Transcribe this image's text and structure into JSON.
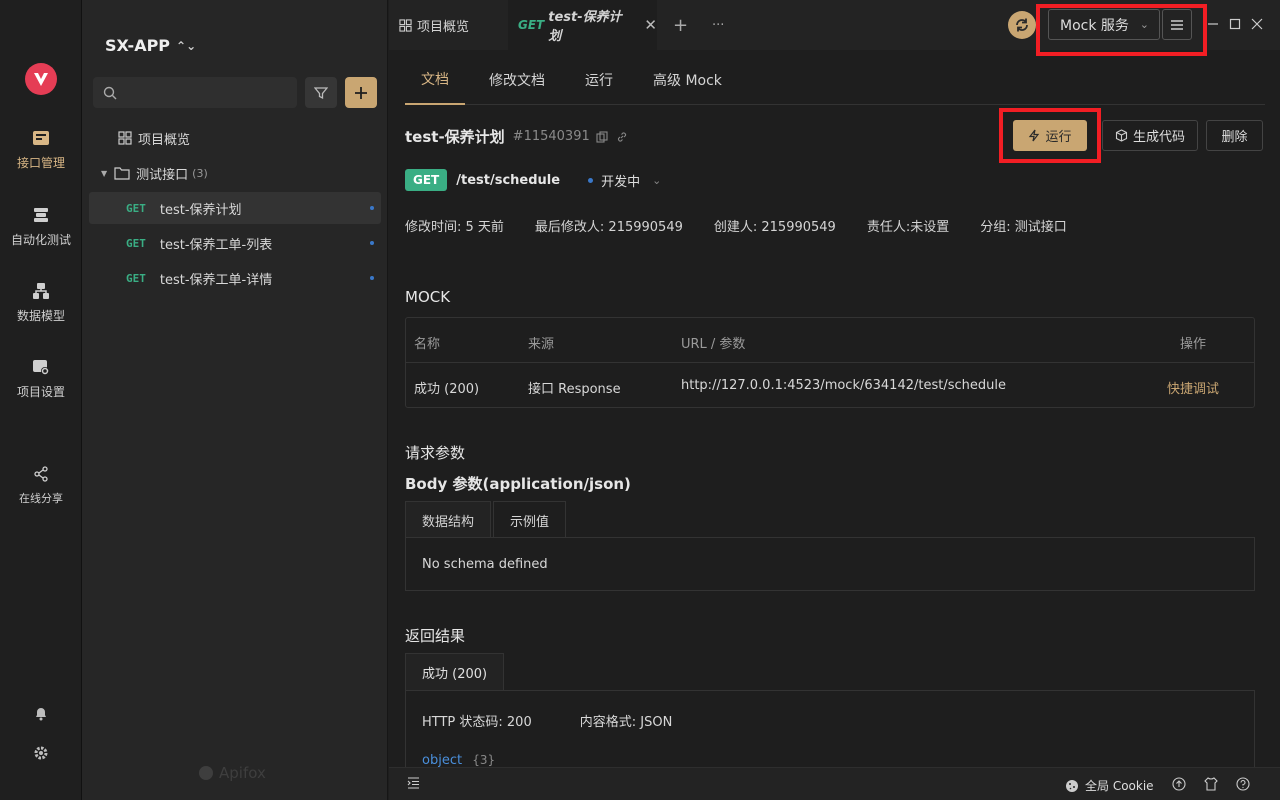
{
  "rail": {
    "items": [
      {
        "label": "接口管理",
        "icon": "api-management-icon",
        "active": true
      },
      {
        "label": "自动化测试",
        "icon": "automation-test-icon",
        "active": false
      },
      {
        "label": "数据模型",
        "icon": "data-model-icon",
        "active": false
      },
      {
        "label": "项目设置",
        "icon": "project-settings-icon",
        "active": false
      }
    ],
    "share_label": "在线分享"
  },
  "sidebar": {
    "project_name": "SX-APP",
    "search": {
      "value": "",
      "placeholder": ""
    },
    "overview_label": "项目概览",
    "folder": {
      "label": "测试接口",
      "count": "(3)"
    },
    "apis": [
      {
        "method": "GET",
        "name": "test-保养计划",
        "selected": true
      },
      {
        "method": "GET",
        "name": "test-保养工单-列表",
        "selected": false
      },
      {
        "method": "GET",
        "name": "test-保养工单-详情",
        "selected": false
      }
    ],
    "brand": "Apifox"
  },
  "tabbar": {
    "overview_tab": "项目概览",
    "active_tab": {
      "method": "GET",
      "name": "test-保养计划"
    },
    "add": "+",
    "more": "···",
    "mock_service": "Mock 服务"
  },
  "subtabs": [
    "文档",
    "修改文档",
    "运行",
    "高级 Mock"
  ],
  "api": {
    "name": "test-保养计划",
    "id": "#11540391",
    "method": "GET",
    "path": "/test/schedule",
    "status": "开发中",
    "buttons": {
      "run": "运行",
      "gen_code": "生成代码",
      "delete": "删除"
    },
    "meta": [
      "修改时间: 5 天前",
      "最后修改人: 215990549",
      "创建人: 215990549",
      "责任人:未设置",
      "分组: 测试接口"
    ]
  },
  "mock": {
    "title": "MOCK",
    "headers": [
      "名称",
      "来源",
      "URL / 参数",
      "操作"
    ],
    "row": {
      "name": "成功 (200)",
      "source": "接口 Response",
      "url": "http://127.0.0.1:4523/mock/634142/test/schedule",
      "action": "快捷调试"
    }
  },
  "request": {
    "title": "请求参数",
    "body_title": "Body 参数(application/json)",
    "tabs": [
      "数据结构",
      "示例值"
    ],
    "empty": "No schema defined"
  },
  "response": {
    "title": "返回结果",
    "tab": "成功 (200)",
    "http_code": "HTTP 状态码: 200",
    "format": "内容格式: JSON",
    "object_label": "object",
    "object_braces": "{3}"
  },
  "statusbar": {
    "cookie_label": "全局 Cookie"
  },
  "colors": {
    "accent": "#c9a672",
    "get_green": "#3aae84",
    "highlight_red": "#f21e24",
    "logo_red": "#e53d55"
  }
}
